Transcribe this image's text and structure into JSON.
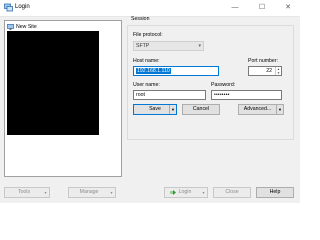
{
  "window": {
    "title": "Login",
    "minimize_glyph": "—",
    "maximize_glyph": "☐",
    "close_glyph": "✕"
  },
  "tree": {
    "items": [
      {
        "label": "New Site",
        "icon": "monitor-icon"
      }
    ]
  },
  "session": {
    "group_label": "Session",
    "protocol_label": "File protocol:",
    "protocol_value": "SFTP",
    "host_label": "Host name:",
    "host_value": "192.168.1.110",
    "port_label": "Port number:",
    "port_value": "22",
    "user_label": "User name:",
    "user_value": "root",
    "password_label": "Password:",
    "password_value": "••••••••",
    "save_label": "Save",
    "cancel_label": "Cancel",
    "advanced_label": "Advanced..."
  },
  "bottom": {
    "tools_label": "Tools",
    "manage_label": "Manage",
    "login_label": "Login",
    "close_label": "Close",
    "help_label": "Help"
  },
  "colors": {
    "accent": "#0078d7",
    "tree_blackout": "#000000",
    "login_icon": "#2e9a2e"
  }
}
